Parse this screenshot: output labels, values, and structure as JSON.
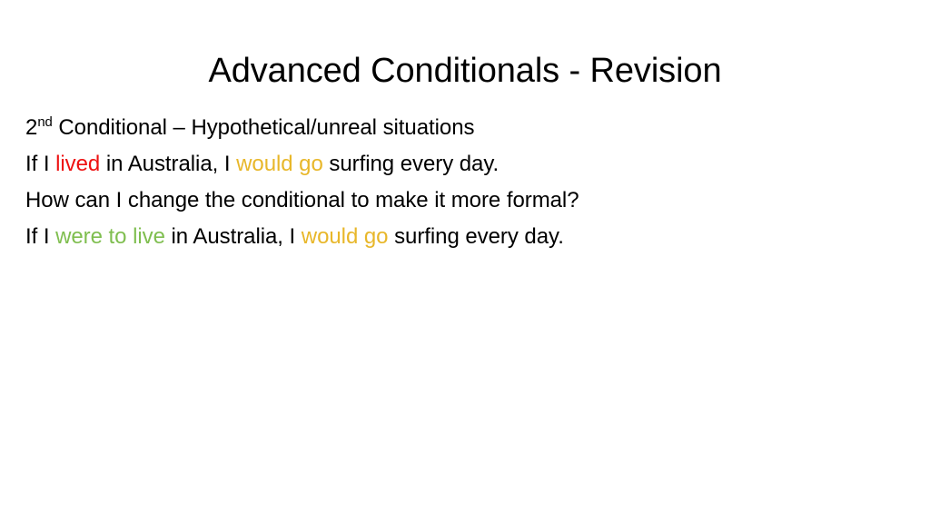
{
  "slide": {
    "background_color": "#ffffff",
    "title": "Advanced Conditionals - Revision",
    "lines": [
      {
        "id": "line-1-conditional-type",
        "segments": [
          {
            "text": "2",
            "style": "plain"
          },
          {
            "text": "nd",
            "style": "superscript"
          },
          {
            "text": " Conditional – Hypothetical/unreal situations",
            "style": "plain"
          }
        ]
      },
      {
        "id": "line-2-example-informal",
        "segments": [
          {
            "text": "If I ",
            "style": "plain"
          },
          {
            "text": "lived",
            "style": "red"
          },
          {
            "text": " in Australia, I ",
            "style": "plain"
          },
          {
            "text": "would go",
            "style": "gold"
          },
          {
            "text": " surfing every day.",
            "style": "plain"
          }
        ]
      },
      {
        "id": "line-3-question",
        "segments": [
          {
            "text": "How can I change the conditional to make it more formal?",
            "style": "plain"
          }
        ]
      },
      {
        "id": "line-4-example-formal",
        "segments": [
          {
            "text": "If I ",
            "style": "plain"
          },
          {
            "text": "were to live",
            "style": "green"
          },
          {
            "text": " in Australia, I ",
            "style": "plain"
          },
          {
            "text": "would go",
            "style": "gold"
          },
          {
            "text": " surfing every day.",
            "style": "plain"
          }
        ]
      }
    ],
    "colors": {
      "text": "#000000",
      "highlight_red": "#ee1111",
      "highlight_gold": "#e8b72a",
      "highlight_green": "#7fbe4f"
    }
  }
}
